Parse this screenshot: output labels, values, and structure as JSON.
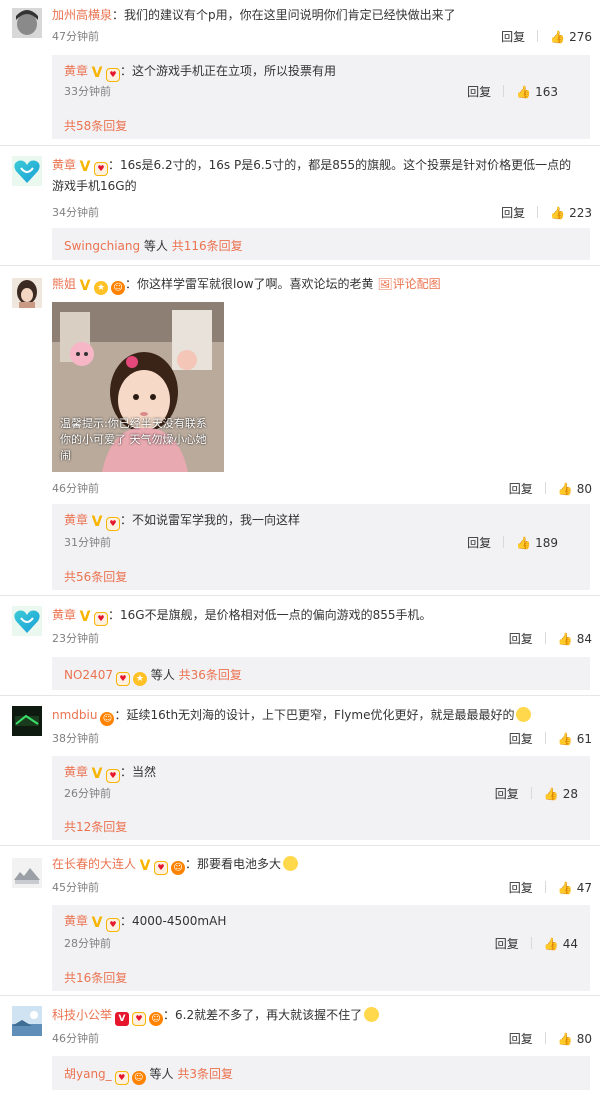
{
  "comments": [
    {
      "user": "加州高横泉",
      "text": "：我们的建议有个p用，你在这里问说明你们肯定已经快做出来了",
      "time": "47分钟前",
      "reply_label": "回复",
      "likes": "276",
      "reply": {
        "user": "黄章",
        "text": "：这个游戏手机正在立项，所以投票有用",
        "time": "33分钟前",
        "reply_label": "回复",
        "likes": "163"
      },
      "more": "共58条回复"
    },
    {
      "user": "黄章",
      "text": "：16s是6.2寸的，16s P是6.5寸的，都是855的旗舰。这个投票是针对价格更低一点的",
      "text2": "游戏手机16G的",
      "time": "34分钟前",
      "reply_label": "回复",
      "likes": "223",
      "more_user": "Swingchiang",
      "more_mid": " 等人 ",
      "more": "共116条回复"
    },
    {
      "user": "熊姐",
      "text": "：你这样学雷军就很low了啊。喜欢论坛的老黄",
      "link": "评论配图",
      "photo_caption": "温馨提示:你已经半天没有联系你的小可爱了 天气勿燥小心她闹",
      "time": "46分钟前",
      "reply_label": "回复",
      "likes": "80",
      "reply": {
        "user": "黄章",
        "text": "：不如说雷军学我的，我一向这样",
        "time": "31分钟前",
        "reply_label": "回复",
        "likes": "189"
      },
      "more": "共56条回复"
    },
    {
      "user": "黄章",
      "text": "：16G不是旗舰，是价格相对低一点的偏向游戏的855手机。",
      "time": "23分钟前",
      "reply_label": "回复",
      "likes": "84",
      "more_user": "NO2407",
      "more_mid": " 等人 ",
      "more": "共36条回复"
    },
    {
      "user": "nmdbiu",
      "text": "：延续16th无刘海的设计，上下巴更窄，Flyme优化更好，就是最最最好的",
      "time": "38分钟前",
      "reply_label": "回复",
      "likes": "61",
      "reply": {
        "user": "黄章",
        "text": "：当然",
        "time": "26分钟前",
        "reply_label": "回复",
        "likes": "28"
      },
      "more": "共12条回复"
    },
    {
      "user": "在长春的大连人",
      "text": "：那要看电池多大",
      "time": "45分钟前",
      "reply_label": "回复",
      "likes": "47",
      "reply": {
        "user": "黄章",
        "text": "：4000-4500mAH",
        "time": "28分钟前",
        "reply_label": "回复",
        "likes": "44"
      },
      "more": "共16条回复"
    },
    {
      "user": "科技小公举",
      "text": "：6.2就差不多了，再大就该握不住了",
      "time": "46分钟前",
      "reply_label": "回复",
      "likes": "80",
      "more_user": "胡yang_",
      "more_mid": " 等人 ",
      "more": "共3条回复"
    }
  ]
}
